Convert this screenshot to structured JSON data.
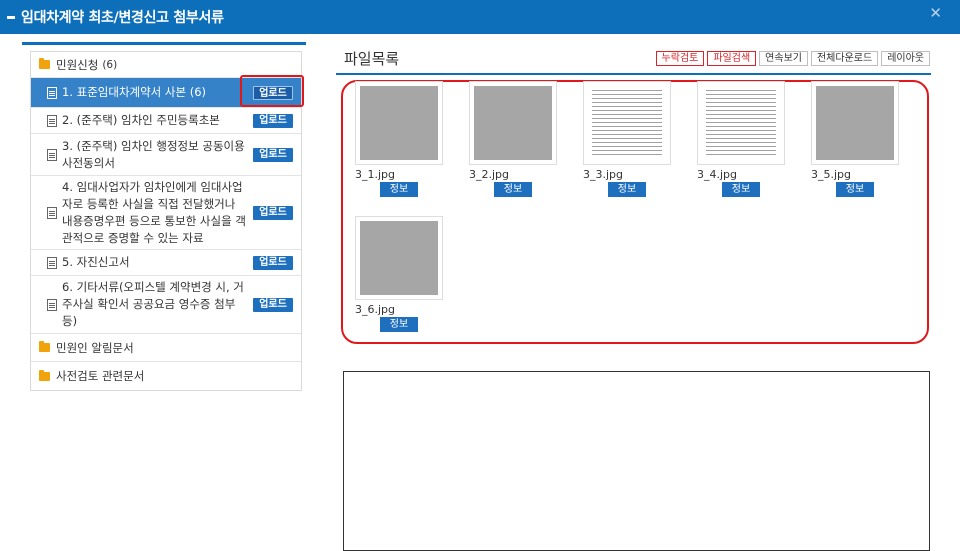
{
  "window": {
    "title": "임대차계약 최초/변경신고 첨부서류",
    "close_symbol": "✕"
  },
  "tree": {
    "groups": [
      {
        "label": "민원신청",
        "count": "(6)",
        "items": [
          {
            "label": "1. 표준임대차계약서 사본 (6)",
            "upload": "업로드",
            "selected": true
          },
          {
            "label": "2. (준주택) 임차인 주민등록초본",
            "upload": "업로드"
          },
          {
            "label": "3. (준주택) 임차인 행정정보 공동이용 사전동의서",
            "upload": "업로드"
          },
          {
            "label": "4. 임대사업자가 임차인에게 임대사업자로 등록한 사실을 직접 전달했거나 내용증명우편 등으로 통보한 사실을 객관적으로 증명할 수 있는 자료",
            "upload": "업로드"
          },
          {
            "label": "5. 자진신고서",
            "upload": "업로드"
          },
          {
            "label": "6. 기타서류(오피스텔 계약변경 시, 거주사실 확인서 공공요금 영수증 첨부 등)",
            "upload": "업로드"
          }
        ]
      },
      {
        "label": "민원인 알림문서"
      },
      {
        "label": "사전검토 관련문서"
      }
    ]
  },
  "file_list": {
    "title": "파일목록",
    "buttons": [
      {
        "label": "누락검토",
        "style": "red"
      },
      {
        "label": "파일검색",
        "style": "red"
      },
      {
        "label": "연속보기",
        "style": "normal"
      },
      {
        "label": "전체다운로드",
        "style": "normal"
      },
      {
        "label": "레이아웃",
        "style": "normal"
      }
    ],
    "files": [
      {
        "name": "3_1.jpg",
        "info": "정보",
        "kind": "gray"
      },
      {
        "name": "3_2.jpg",
        "info": "정보",
        "kind": "gray"
      },
      {
        "name": "3_3.jpg",
        "info": "정보",
        "kind": "doc"
      },
      {
        "name": "3_4.jpg",
        "info": "정보",
        "kind": "doc"
      },
      {
        "name": "3_5.jpg",
        "info": "정보",
        "kind": "gray"
      },
      {
        "name": "3_6.jpg",
        "info": "정보",
        "kind": "gray"
      }
    ]
  },
  "colors": {
    "accent": "#0d6fba",
    "highlight": "#e0181b"
  }
}
